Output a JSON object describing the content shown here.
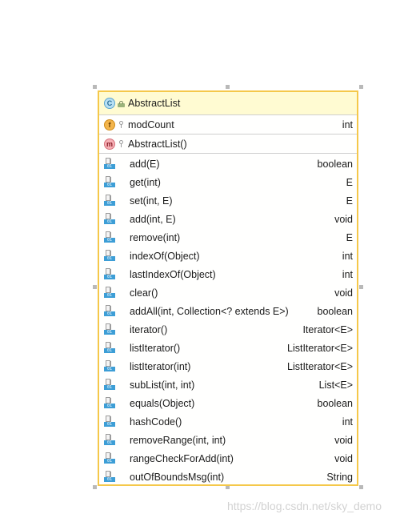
{
  "class_box": {
    "name": "AbstractList",
    "class_icon": "C",
    "abstract_icon": "abstract-lock-icon",
    "fields": [
      {
        "icon": "f",
        "name": "modCount",
        "type": "int"
      }
    ],
    "constructors": [
      {
        "icon": "m",
        "name": "AbstractList()",
        "type": ""
      }
    ],
    "methods": [
      {
        "name": "add(E)",
        "type": "boolean"
      },
      {
        "name": "get(int)",
        "type": "E"
      },
      {
        "name": "set(int, E)",
        "type": "E"
      },
      {
        "name": "add(int, E)",
        "type": "void"
      },
      {
        "name": "remove(int)",
        "type": "E"
      },
      {
        "name": "indexOf(Object)",
        "type": "int"
      },
      {
        "name": "lastIndexOf(Object)",
        "type": "int"
      },
      {
        "name": "clear()",
        "type": "void"
      },
      {
        "name": "addAll(int, Collection<? extends E>)",
        "type": "boolean"
      },
      {
        "name": "iterator()",
        "type": "Iterator<E>"
      },
      {
        "name": "listIterator()",
        "type": "ListIterator<E>"
      },
      {
        "name": "listIterator(int)",
        "type": "ListIterator<E>"
      },
      {
        "name": "subList(int, int)",
        "type": "List<E>"
      },
      {
        "name": "equals(Object)",
        "type": "boolean"
      },
      {
        "name": "hashCode()",
        "type": "int"
      },
      {
        "name": "removeRange(int, int)",
        "type": "void"
      },
      {
        "name": "rangeCheckForAdd(int)",
        "type": "void"
      },
      {
        "name": "outOfBoundsMsg(int)",
        "type": "String"
      }
    ],
    "method_badge": "01"
  },
  "watermark": "https://blog.csdn.net/sky_demo",
  "colors": {
    "border": "#f5c84a",
    "header_bg": "#fffbd2",
    "method_badge": "#3d9ed6"
  }
}
